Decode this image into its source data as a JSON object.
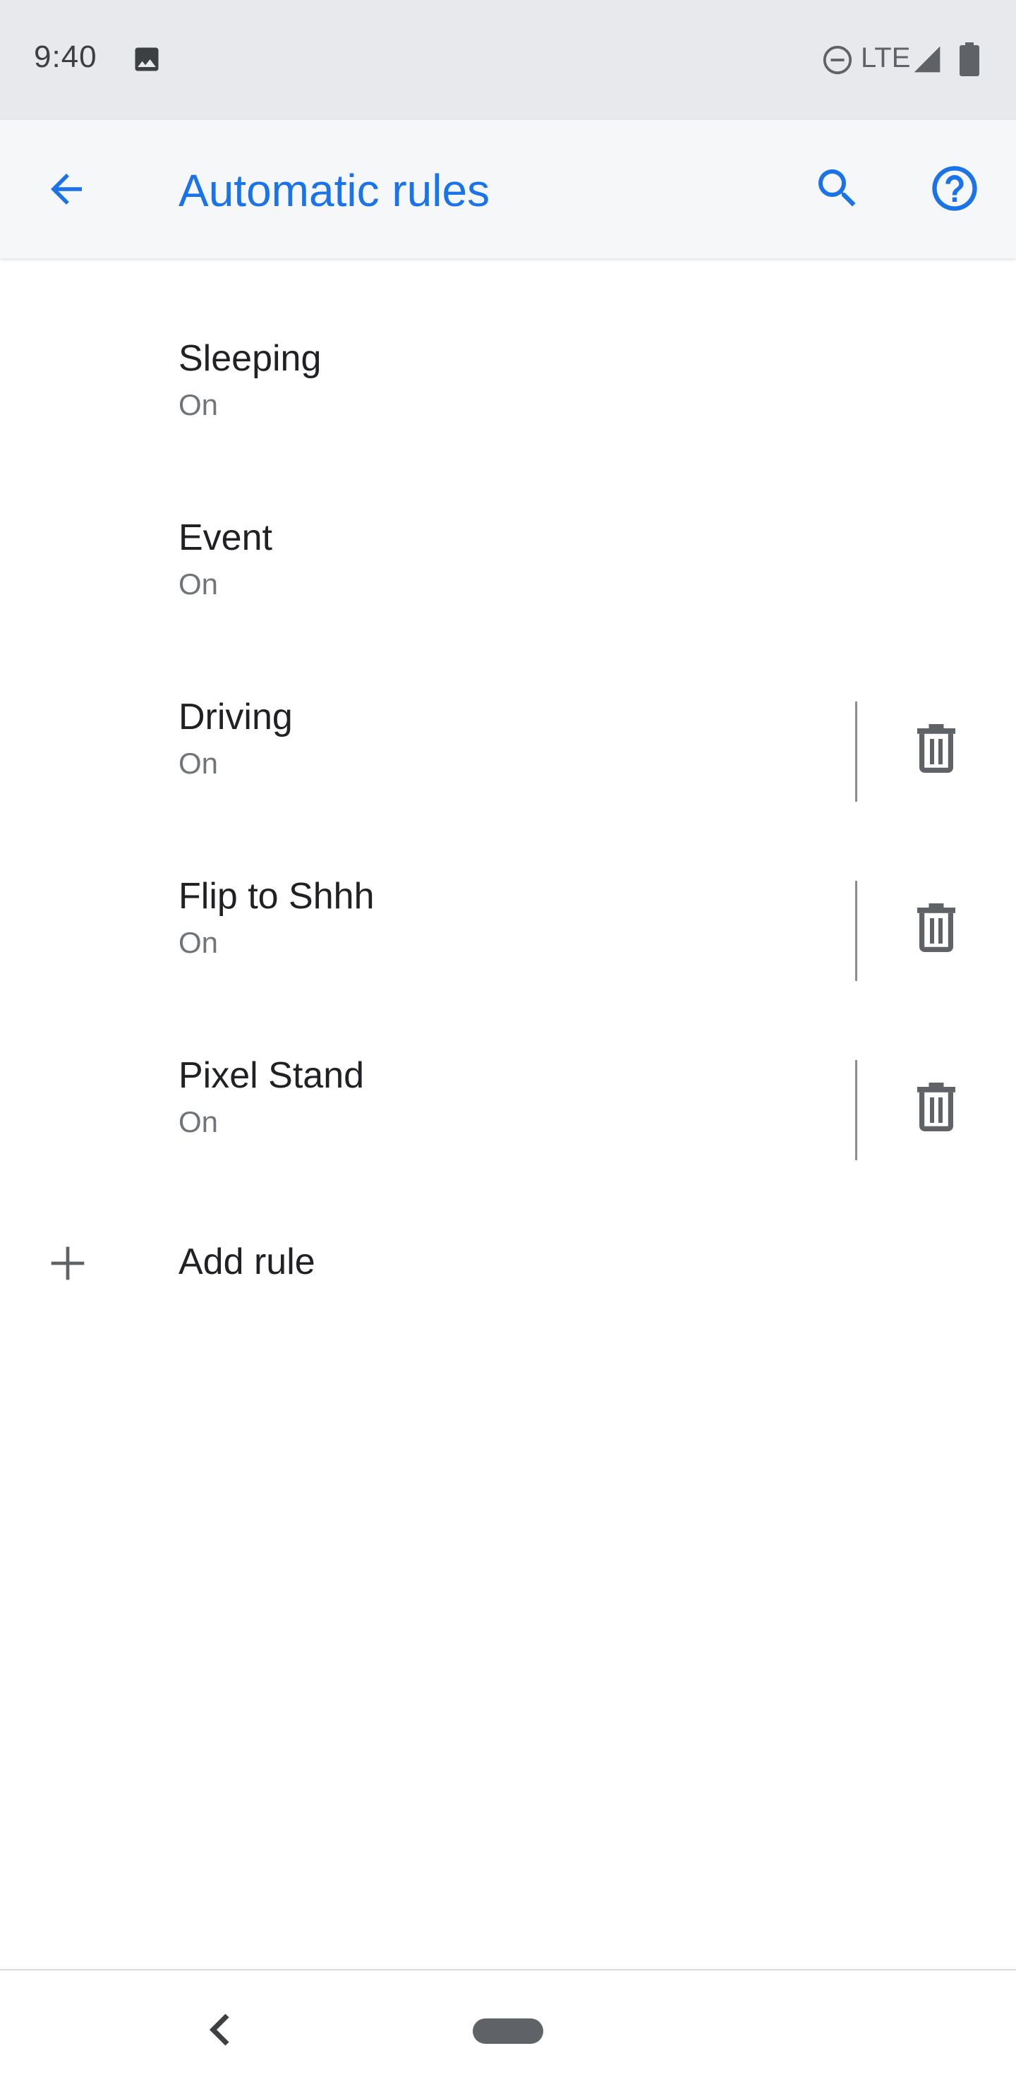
{
  "status_bar": {
    "time": "9:40",
    "network": "LTE",
    "icons": [
      "image-icon",
      "do-not-disturb-icon",
      "signal-icon",
      "battery-icon"
    ]
  },
  "app_bar": {
    "title": "Automatic rules",
    "icons": [
      "back-arrow-icon",
      "search-icon",
      "help-icon"
    ],
    "accent_color": "#1a73e8"
  },
  "rules": [
    {
      "title": "Sleeping",
      "status": "On",
      "deletable": false
    },
    {
      "title": "Event",
      "status": "On",
      "deletable": false
    },
    {
      "title": "Driving",
      "status": "On",
      "deletable": true
    },
    {
      "title": "Flip to Shhh",
      "status": "On",
      "deletable": true
    },
    {
      "title": "Pixel Stand",
      "status": "On",
      "deletable": true
    }
  ],
  "add_rule": {
    "label": "Add rule",
    "icon": "plus-icon"
  },
  "nav_bar": {
    "icons": [
      "nav-back-icon",
      "home-pill"
    ]
  }
}
